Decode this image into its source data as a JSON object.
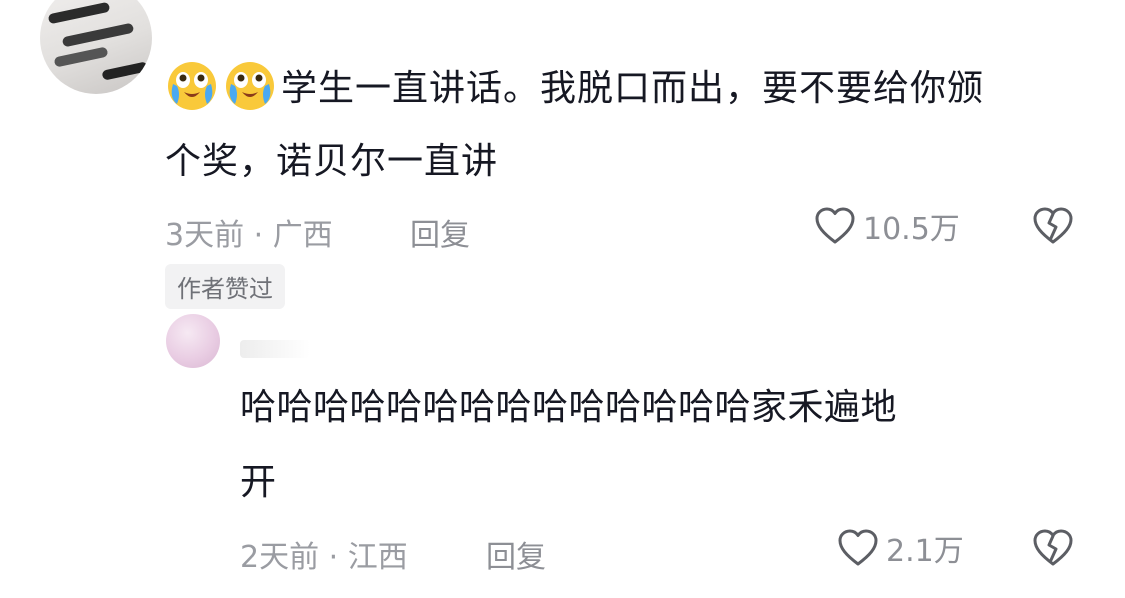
{
  "comments": [
    {
      "emoji": [
        "crying-laughing-emoji",
        "crying-laughing-emoji"
      ],
      "text_line1": "学生一直讲话。我脱口而出，要不要给你颁",
      "text_line2": "个奖，诺贝尔一直讲",
      "time": "3天前",
      "separator": "·",
      "location": "广西",
      "reply_label": "回复",
      "likes": "10.5万",
      "badge": "作者赞过"
    },
    {
      "text_line1": "哈哈哈哈哈哈哈哈哈哈哈哈哈哈家禾遍地",
      "text_line2": "开",
      "time": "2天前",
      "separator": "·",
      "location": "江西",
      "reply_label": "回复",
      "likes": "2.1万"
    }
  ],
  "icons": {
    "like": "heart-outline-icon",
    "dislike": "broken-heart-icon"
  },
  "colors": {
    "text_primary": "#161823",
    "text_meta": "#9a9ca2",
    "badge_bg": "#f2f2f3"
  }
}
